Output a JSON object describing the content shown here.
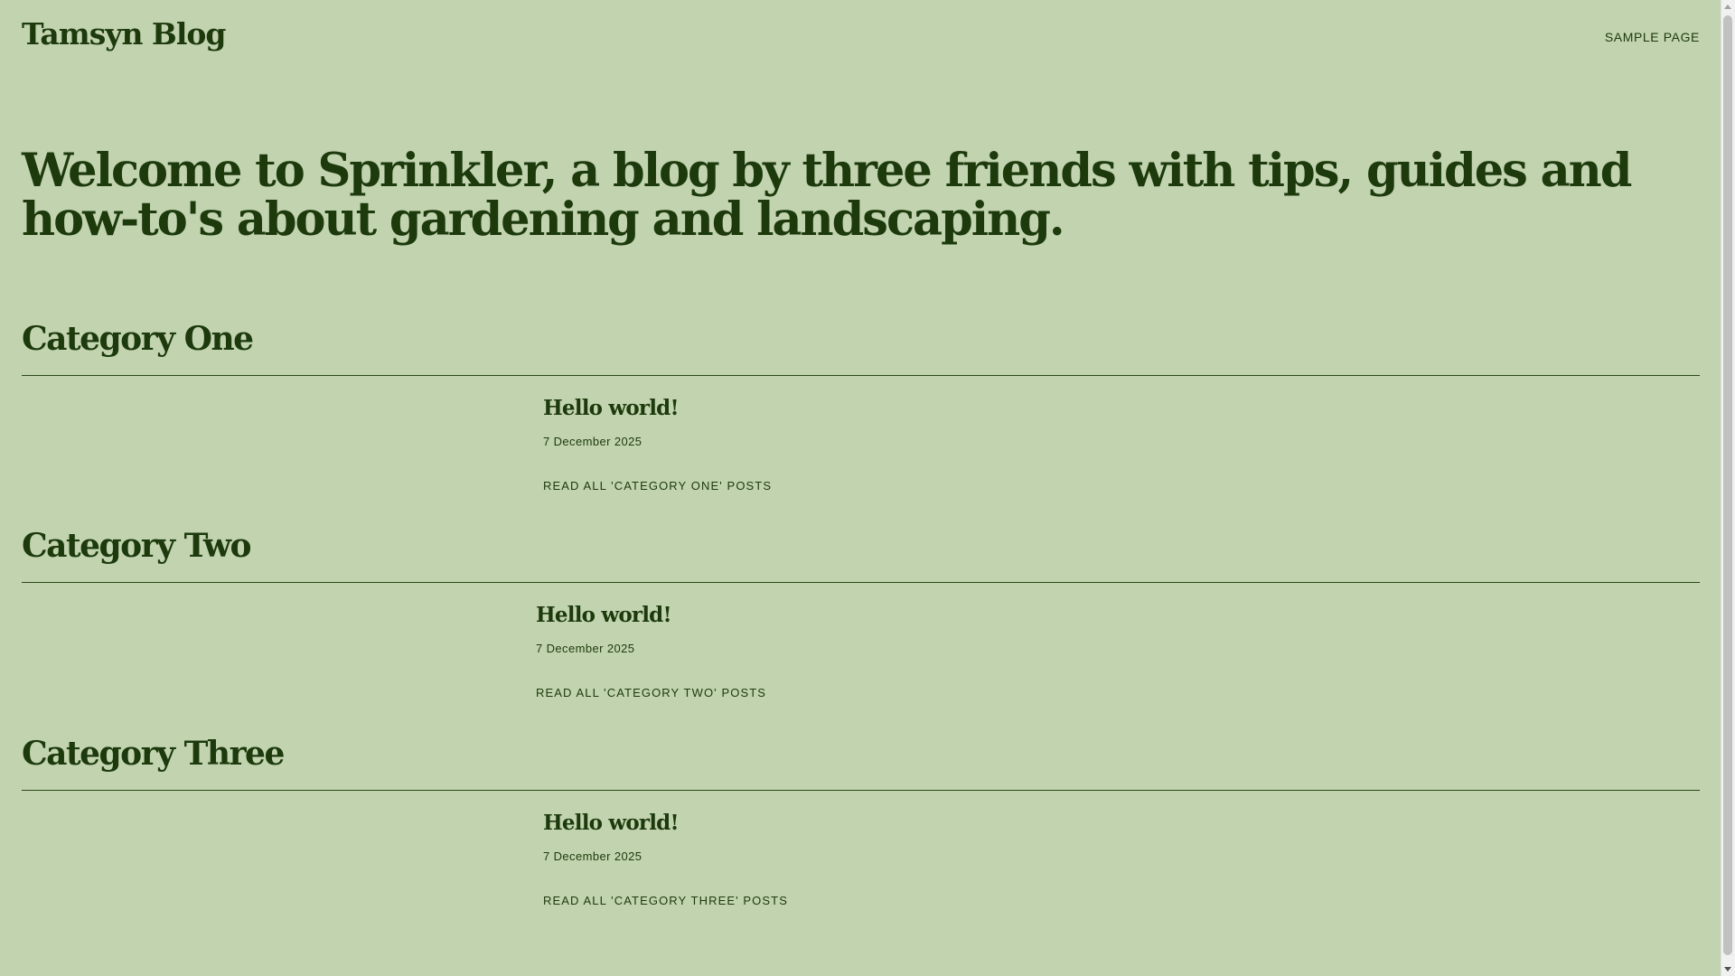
{
  "header": {
    "site_title": "Tamsyn Blog",
    "nav": {
      "sample_page": "SAMPLE PAGE"
    }
  },
  "hero": {
    "text": "Welcome to Sprinkler, a blog by three friends with tips, guides and how-to's about gardening and landscaping."
  },
  "categories": [
    {
      "title": "Category One",
      "post": {
        "title": "Hello world!",
        "date": "7 December 2025",
        "read_all": "READ ALL 'CATEGORY ONE' POSTS"
      }
    },
    {
      "title": "Category Two",
      "post": {
        "title": "Hello world!",
        "date": "7 December 2025",
        "read_all": "READ ALL 'CATEGORY TWO' POSTS"
      }
    },
    {
      "title": "Category Three",
      "post": {
        "title": "Hello world!",
        "date": "7 December 2025",
        "read_all": "READ ALL 'CATEGORY THREE' POSTS"
      }
    }
  ],
  "colors": {
    "background": "#c2d3af",
    "text": "#1c3a0c"
  }
}
